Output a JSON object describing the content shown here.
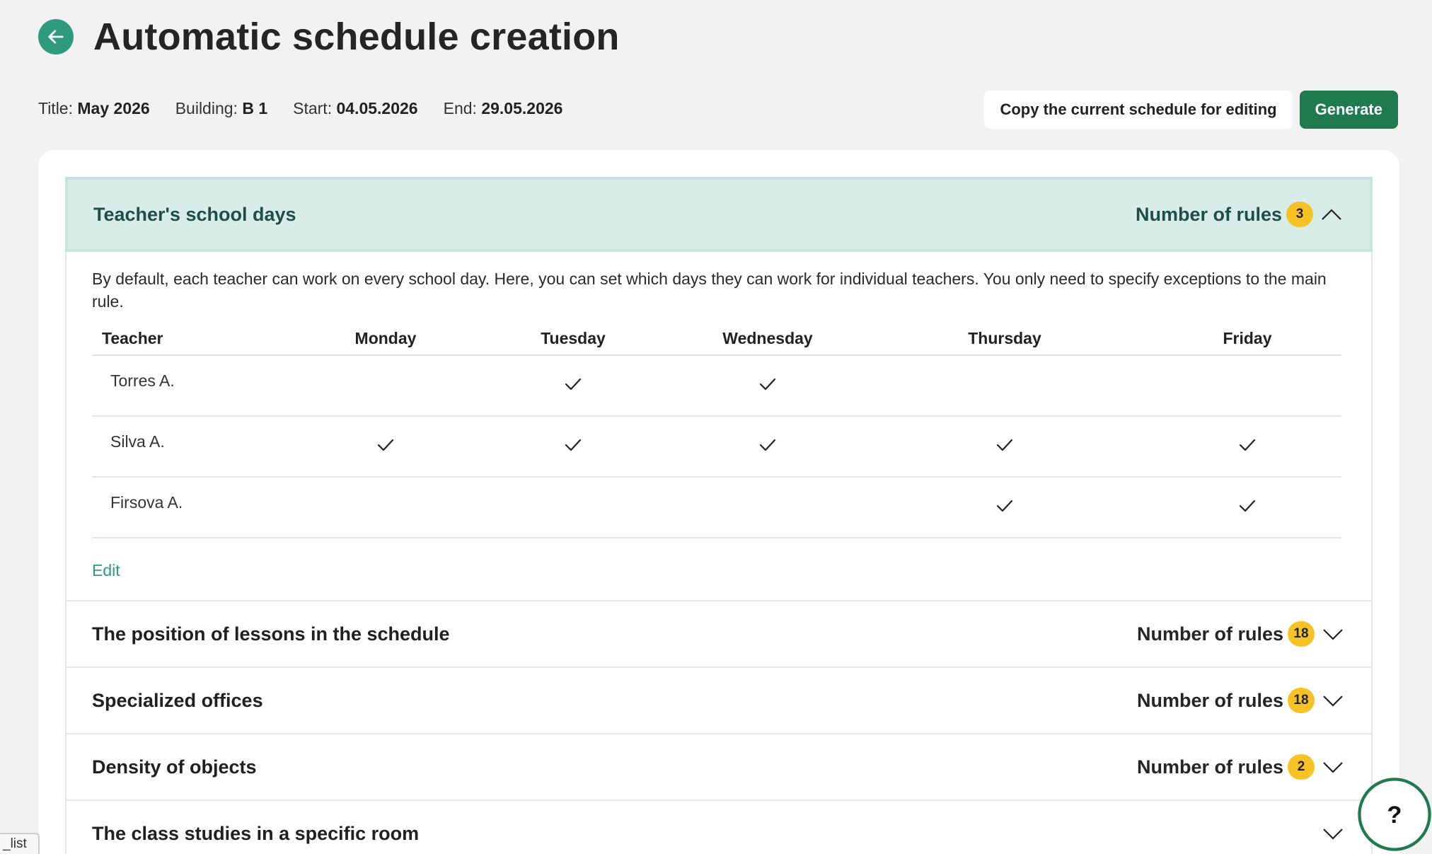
{
  "header": {
    "title": "Automatic schedule creation"
  },
  "meta": {
    "title_label": "Title:",
    "title_value": "May 2026",
    "building_label": "Building:",
    "building_value": "B 1",
    "start_label": "Start:",
    "start_value": "04.05.2026",
    "end_label": "End:",
    "end_value": "29.05.2026"
  },
  "actions": {
    "copy_label": "Copy the current schedule for editing",
    "generate_label": "Generate"
  },
  "sections": {
    "teacher_days": {
      "title": "Teacher's school days",
      "rules_label": "Number of rules",
      "rules_count": "3",
      "description": "By default, each teacher can work on every school day. Here, you can set which days they can work for individual teachers. You only need to specify exceptions to the main rule.",
      "columns": [
        "Teacher",
        "Monday",
        "Tuesday",
        "Wednesday",
        "Thursday",
        "Friday"
      ],
      "rows": [
        {
          "teacher": "Torres A.",
          "days": [
            false,
            true,
            true,
            false,
            false
          ]
        },
        {
          "teacher": "Silva A.",
          "days": [
            true,
            true,
            true,
            true,
            true
          ]
        },
        {
          "teacher": "Firsova A.",
          "days": [
            false,
            false,
            false,
            true,
            true
          ]
        }
      ],
      "edit_label": "Edit"
    },
    "others": [
      {
        "title": "The position of lessons in the schedule",
        "rules_label": "Number of rules",
        "rules_count": "18"
      },
      {
        "title": "Specialized offices",
        "rules_label": "Number of rules",
        "rules_count": "18"
      },
      {
        "title": "Density of objects",
        "rules_label": "Number of rules",
        "rules_count": "2"
      },
      {
        "title": "The class studies in a specific room",
        "rules_label": "",
        "rules_count": ""
      }
    ]
  },
  "help": {
    "label": "?"
  },
  "corner_tab": {
    "label": "_list"
  },
  "colors": {
    "accent": "#2e9c7c",
    "primary_button": "#1f7a4e",
    "badge": "#f6c226",
    "open_header": "#d8ede8"
  }
}
